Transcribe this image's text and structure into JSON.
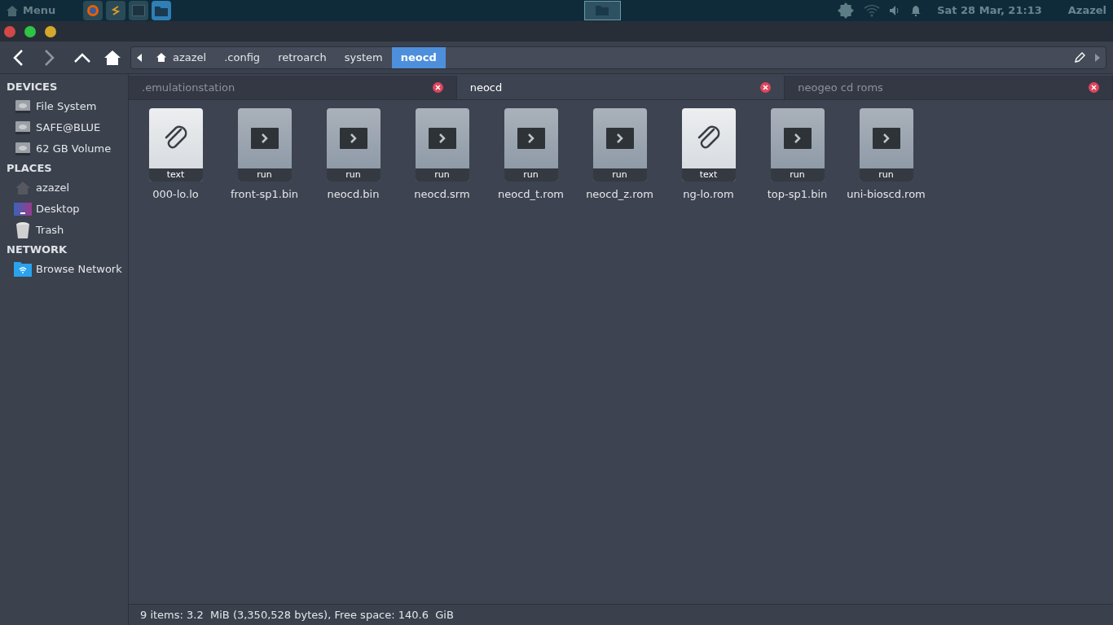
{
  "top_panel": {
    "menu_label": "Menu",
    "launchers": [
      {
        "kind": "firefox",
        "selected": false
      },
      {
        "kind": "editor",
        "selected": false
      },
      {
        "kind": "terminal",
        "selected": false
      },
      {
        "kind": "folder",
        "selected": true
      }
    ],
    "clock": "Sat 28 Mar, 21:13",
    "user": "Azazel"
  },
  "toolbar": {
    "breadcrumbs": [
      {
        "label": "azazel",
        "home": true,
        "selected": false
      },
      {
        "label": ".config",
        "home": false,
        "selected": false
      },
      {
        "label": "retroarch",
        "home": false,
        "selected": false
      },
      {
        "label": "system",
        "home": false,
        "selected": false
      },
      {
        "label": "neocd",
        "home": false,
        "selected": true
      }
    ]
  },
  "sidebar": {
    "sections": [
      {
        "title": "DEVICES",
        "items": [
          {
            "label": "File System",
            "kind": "drive"
          },
          {
            "label": "SAFE@BLUE",
            "kind": "drive"
          },
          {
            "label": "62 GB Volume",
            "kind": "drive"
          }
        ]
      },
      {
        "title": "PLACES",
        "items": [
          {
            "label": "azazel",
            "kind": "home"
          },
          {
            "label": "Desktop",
            "kind": "desktop"
          },
          {
            "label": "Trash",
            "kind": "trash"
          }
        ]
      },
      {
        "title": "NETWORK",
        "items": [
          {
            "label": "Browse Network",
            "kind": "network"
          }
        ]
      }
    ]
  },
  "tabs": [
    {
      "label": ".emulationstation",
      "selected": false
    },
    {
      "label": "neocd",
      "selected": true
    },
    {
      "label": "neogeo cd roms",
      "selected": false
    }
  ],
  "files": [
    {
      "name": "000-lo.lo",
      "kind": "text",
      "badge": "text"
    },
    {
      "name": "front-sp1.bin",
      "kind": "run",
      "badge": "run"
    },
    {
      "name": "neocd.bin",
      "kind": "run",
      "badge": "run"
    },
    {
      "name": "neocd.srm",
      "kind": "run",
      "badge": "run"
    },
    {
      "name": "neocd_t.rom",
      "kind": "run",
      "badge": "run"
    },
    {
      "name": "neocd_z.rom",
      "kind": "run",
      "badge": "run"
    },
    {
      "name": "ng-lo.rom",
      "kind": "text",
      "badge": "text"
    },
    {
      "name": "top-sp1.bin",
      "kind": "run",
      "badge": "run"
    },
    {
      "name": "uni-bioscd.rom",
      "kind": "run",
      "badge": "run"
    }
  ],
  "status_bar": "9 items: 3.2  MiB (3,350,528 bytes), Free space: 140.6  GiB"
}
